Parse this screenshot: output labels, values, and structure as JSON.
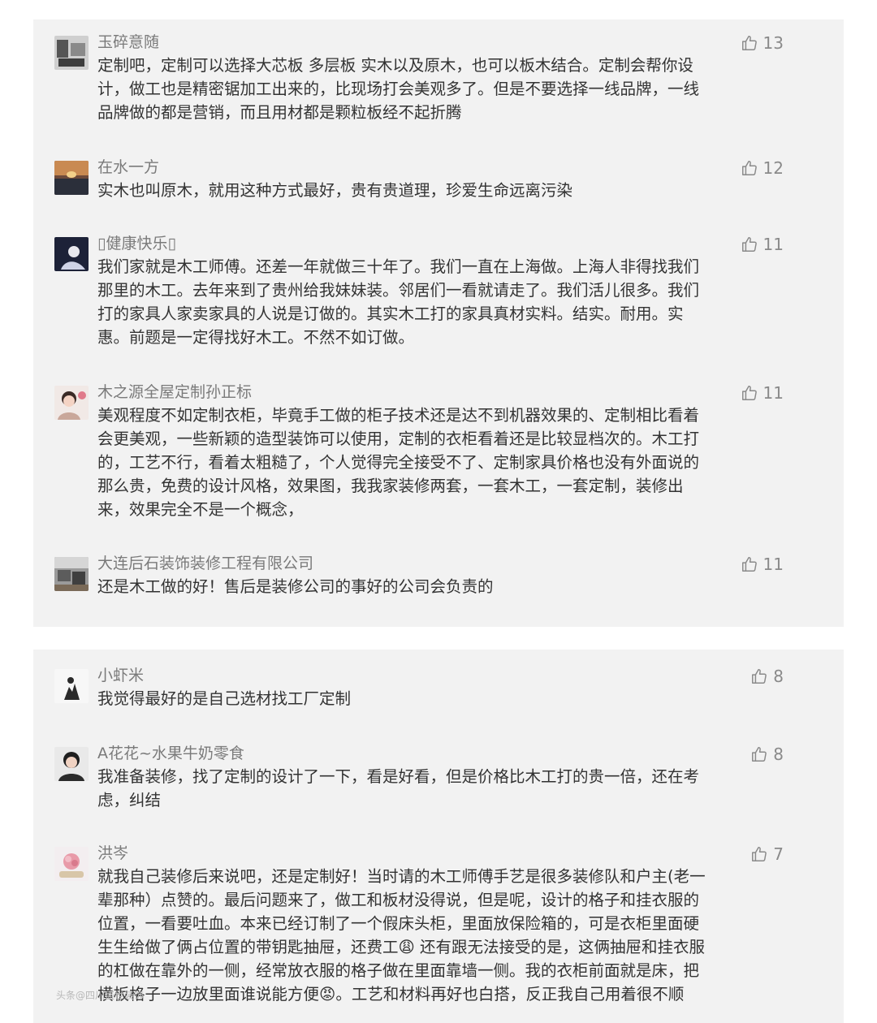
{
  "like_icon": "thumbs-up-icon",
  "panel1": [
    {
      "user": "玉碎意随",
      "likes": "13",
      "text": "定制吧，定制可以选择大芯板 多层板  实木以及原木，也可以板木结合。定制会帮你设\n计，做工也是精密锯加工出来的，比现场打会美观多了。但是不要选择一线品牌，一线\n品牌做的都是营销，而且用材都是颗粒板经不起折腾"
    },
    {
      "user": "在水一方",
      "likes": "12",
      "text": "实木也叫原木，就用这种方式最好，贵有贵道理，珍爱生命远离污染"
    },
    {
      "user": "▯健康快乐▯",
      "likes": "11",
      "text": "我们家就是木工师傅。还差一年就做三十年了。我们一直在上海做。上海人非得找我们\n那里的木工。去年来到了贵州给我妹妹装。邻居们一看就请走了。我们活儿很多。我们\n打的家具人家卖家具的人说是订做的。其实木工打的家具真材实料。结实。耐用。实\n惠。前题是一定得找好木工。不然不如订做。"
    },
    {
      "user": "木之源全屋定制孙正标",
      "likes": "11",
      "text": "美观程度不如定制衣柜，毕竟手工做的柜子技术还是达不到机器效果的、定制相比看着\n会更美观，一些新颖的造型装饰可以使用，定制的衣柜看着还是比较显档次的。木工打\n的，工艺不行，看着太粗糙了，个人觉得完全接受不了、定制家具价格也没有外面说的\n那么贵，免费的设计风格，效果图，我我家装修两套，一套木工，一套定制，装修出\n来，效果完全不是一个概念，"
    },
    {
      "user": "大连后石装饰装修工程有限公司",
      "likes": "11",
      "text": "还是木工做的好！售后是装修公司的事好的公司会负责的"
    }
  ],
  "panel2": [
    {
      "user": "小虾米",
      "likes": "8",
      "text": "我觉得最好的是自己选材找工厂定制"
    },
    {
      "user": "A花花~水果牛奶零食",
      "likes": "8",
      "text": "我准备装修，找了定制的设计了一下，看是好看，但是价格比木工打的贵一倍，还在考\n虑，纠结"
    },
    {
      "user": "洪岑",
      "likes": "7",
      "text": "就我自己装修后来说吧，还是定制好！当时请的木工师傅手艺是很多装修队和户主(老一\n辈那种）点赞的。最后问题来了，做工和板材没得说，但是呢，设计的格子和挂衣服的\n位置，一看要吐血。本来已经订制了一个假床头柜，里面放保险箱的，可是衣柜里面硬\n生生给做了俩占位置的带钥匙抽屉，还费工😩 还有跟无法接受的是，这俩抽屉和挂衣服\n的杠做在靠外的一侧，经常放衣服的格子做在里面靠墙一侧。我的衣柜前面就是床，把\n横板格子一边放里面谁说能方便😡。工艺和材料再好也白搭，反正我自己用着很不顺"
    }
  ],
  "watermark": "头条@四川盛世装饰"
}
